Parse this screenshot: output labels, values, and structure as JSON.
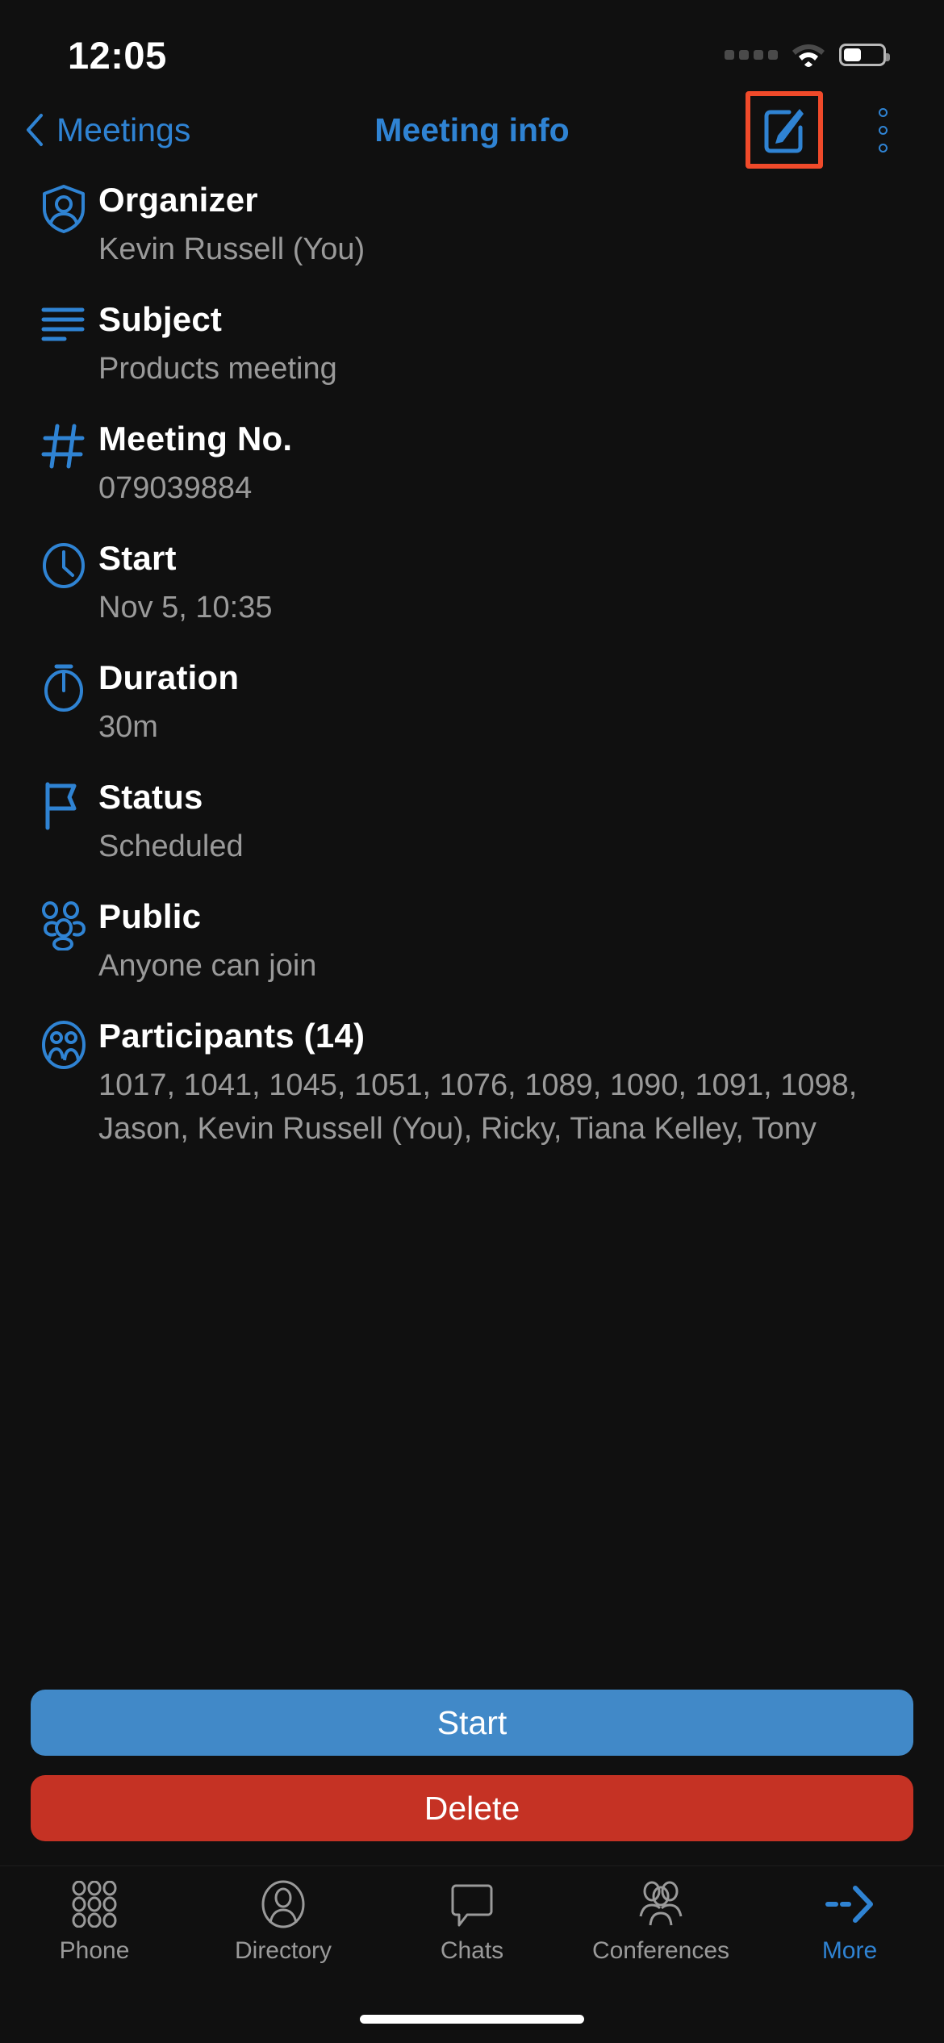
{
  "status_bar": {
    "time": "12:05",
    "battery_percent": 45,
    "icons": [
      "signal-dots-icon",
      "wifi-icon",
      "battery-icon"
    ]
  },
  "nav": {
    "back_label": "Meetings",
    "title": "Meeting info",
    "edit_icon": "edit-pencil-square-icon",
    "overflow_icon": "more-vertical-icon",
    "highlight_color": "#f04a2a",
    "accent_color": "#2f83d3"
  },
  "details": [
    {
      "icon": "shield-person-icon",
      "label": "Organizer",
      "value": "Kevin Russell (You)"
    },
    {
      "icon": "list-lines-icon",
      "label": "Subject",
      "value": "Products meeting"
    },
    {
      "icon": "hash-icon",
      "label": "Meeting No.",
      "value": "079039884"
    },
    {
      "icon": "clock-icon",
      "label": "Start",
      "value": "Nov 5, 10:35"
    },
    {
      "icon": "stopwatch-icon",
      "label": "Duration",
      "value": "30m"
    },
    {
      "icon": "flag-icon",
      "label": "Status",
      "value": "Scheduled"
    },
    {
      "icon": "people-group-icon",
      "label": "Public",
      "value": "Anyone can join"
    },
    {
      "icon": "participants-icon",
      "label": "Participants (14)",
      "value": "1017, 1041, 1045, 1051, 1076, 1089, 1090, 1091, 1098, Jason, Kevin Russell (You), Ricky, Tiana Kelley, Tony"
    }
  ],
  "actions": {
    "start_label": "Start",
    "start_color": "#4189c8",
    "delete_label": "Delete",
    "delete_color": "#c53224"
  },
  "tabs": [
    {
      "label": "Phone",
      "icon": "dialpad-icon",
      "active": false
    },
    {
      "label": "Directory",
      "icon": "contact-icon",
      "active": false
    },
    {
      "label": "Chats",
      "icon": "chat-bubble-icon",
      "active": false
    },
    {
      "label": "Conferences",
      "icon": "group-icon",
      "active": false
    },
    {
      "label": "More",
      "icon": "arrow-right-dashed-icon",
      "active": true
    }
  ]
}
